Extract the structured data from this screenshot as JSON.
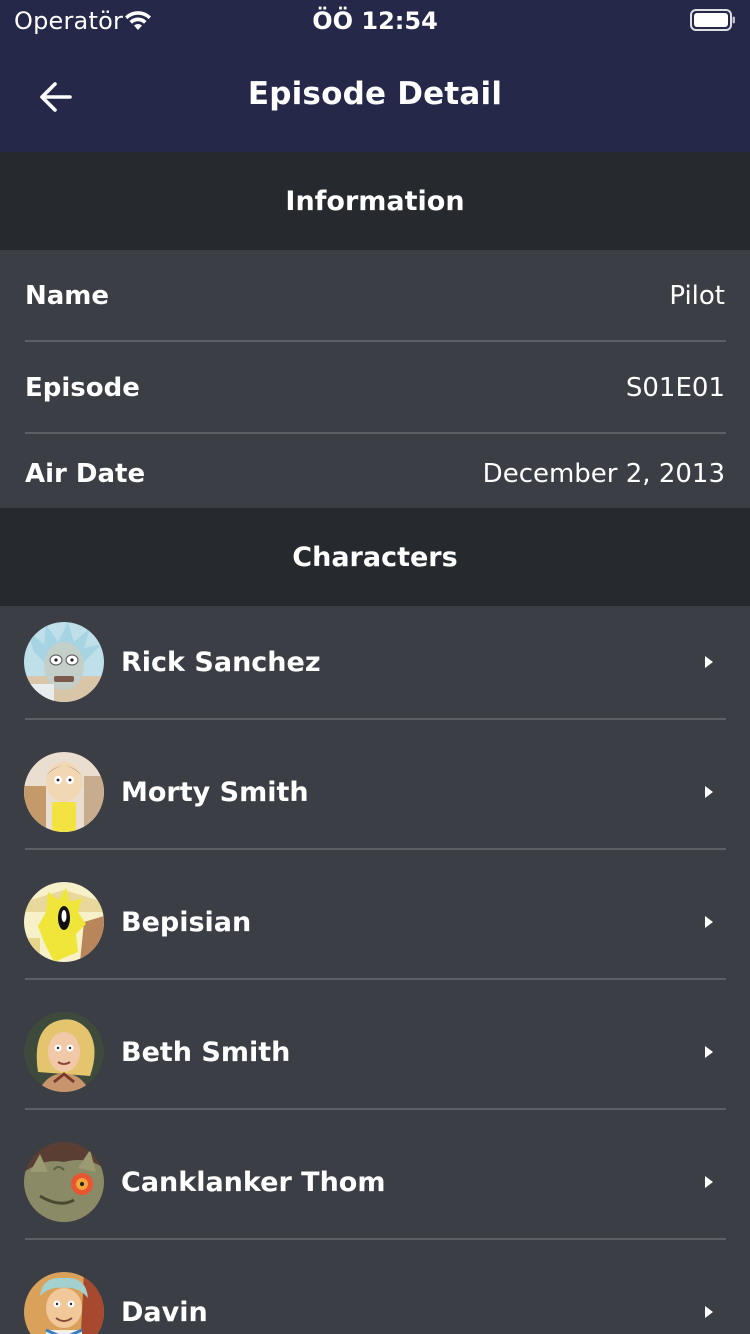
{
  "status_bar": {
    "carrier": "Operatör",
    "time": "ÖÖ 12:54"
  },
  "nav": {
    "title": "Episode Detail",
    "back_icon": "arrow-left-icon"
  },
  "information": {
    "header": "Information",
    "rows": [
      {
        "label": "Name",
        "value": "Pilot"
      },
      {
        "label": "Episode",
        "value": "S01E01"
      },
      {
        "label": "Air Date",
        "value": "December 2, 2013"
      }
    ]
  },
  "characters": {
    "header": "Characters",
    "items": [
      {
        "name": "Rick Sanchez"
      },
      {
        "name": "Morty Smith"
      },
      {
        "name": "Bepisian"
      },
      {
        "name": "Beth Smith"
      },
      {
        "name": "Canklanker Thom"
      },
      {
        "name": "Davin"
      }
    ]
  },
  "colors": {
    "nav_background": "#252849",
    "section_header": "#26292d",
    "row_background": "#3b3e44",
    "divider": "#5c5f64",
    "text": "#ffffff"
  }
}
